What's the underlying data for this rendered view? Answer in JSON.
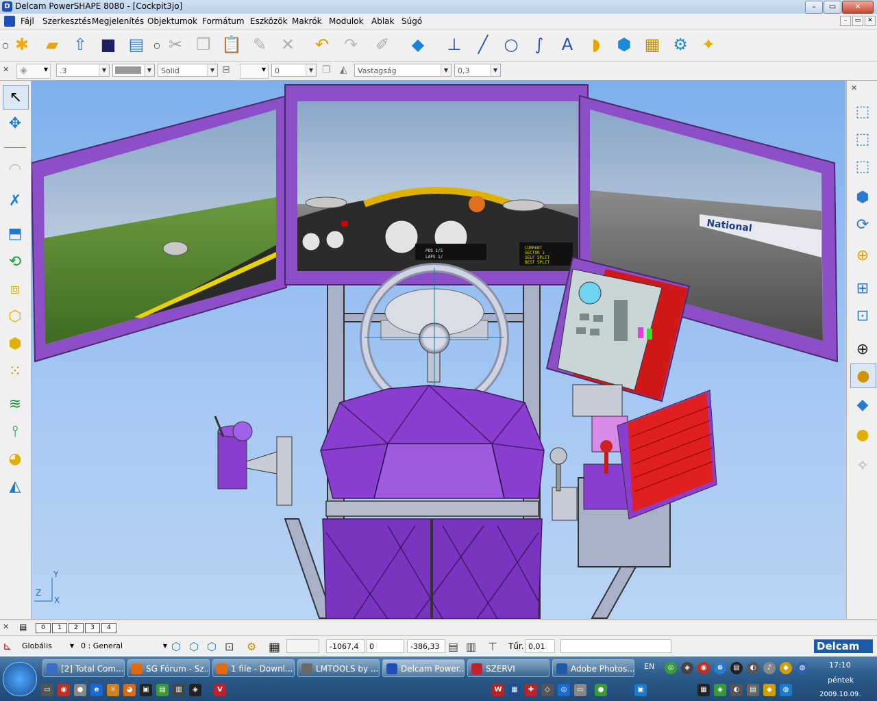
{
  "window": {
    "title": "Delcam PowerSHAPE 8080 - [Cockpit3jo]",
    "buttons": [
      "–",
      "▭",
      "✕"
    ]
  },
  "menu": {
    "items": [
      "Fájl",
      "Szerkesztés",
      "Megjelenítés",
      "Objektumok",
      "Formátum",
      "Eszközök",
      "Makrók",
      "Modulok",
      "Ablak",
      "Súgó"
    ],
    "mdi_buttons": [
      "–",
      "▭",
      "✕"
    ]
  },
  "toolbar": {
    "icons": [
      "new-file-icon",
      "open-folder-icon",
      "import-icon",
      "save-icon",
      "print-icon",
      "cut-icon",
      "copy-icon",
      "paste-icon",
      "edit-icon",
      "delete-icon",
      "undo-icon",
      "redo-icon",
      "pen-icon",
      "shade-icon",
      "workplane-icon",
      "line-icon",
      "circle-icon",
      "curve-icon",
      "text-icon",
      "surface-icon",
      "solid-icon",
      "layer-icon",
      "tools-icon",
      "wizard-icon"
    ]
  },
  "attributes": {
    "line_width": ".3",
    "color": "#9a9a9a",
    "line_style": "Solid",
    "level_value": "0",
    "thickness_label": "Vastagság",
    "thickness_value": "0,3"
  },
  "layers": [
    "0",
    "1",
    "2",
    "3",
    "4"
  ],
  "status": {
    "coord_system": "Globális",
    "workplane": "0  : General",
    "x": "-1067,4",
    "y": "0",
    "z": "-386,33",
    "tolerance_label": "Tűr.",
    "tolerance_value": "0,01",
    "brand": "Delcam"
  },
  "axes": {
    "y": "Y",
    "z": "Z",
    "x": "X"
  },
  "dashboard_text": {
    "line1": "CURRENT",
    "line2": "SECTOR 1",
    "line3": "SELF SPLIT",
    "line4": "BEST SPLIT",
    "pos": "POS 1/5",
    "lap": "LAPS 1/"
  },
  "banner_text": "National",
  "taskbar": {
    "tasks": [
      {
        "label": "[2] Total Com...",
        "color": "#3c6fc4"
      },
      {
        "label": "SG Fórum - Sz...",
        "color": "#e06a12"
      },
      {
        "label": "1 file - Downl...",
        "color": "#e06a12"
      },
      {
        "label": "LMTOOLS by ...",
        "color": "#6a6a6a"
      },
      {
        "label": "Delcam Power...",
        "color": "#1d4fb8"
      },
      {
        "label": "SZERVI",
        "color": "#c0202a"
      },
      {
        "label": "Adobe Photos...",
        "color": "#1f5aa8"
      }
    ],
    "language": "EN",
    "time": "17:10",
    "day": "péntek",
    "date": "2009.10.09."
  }
}
